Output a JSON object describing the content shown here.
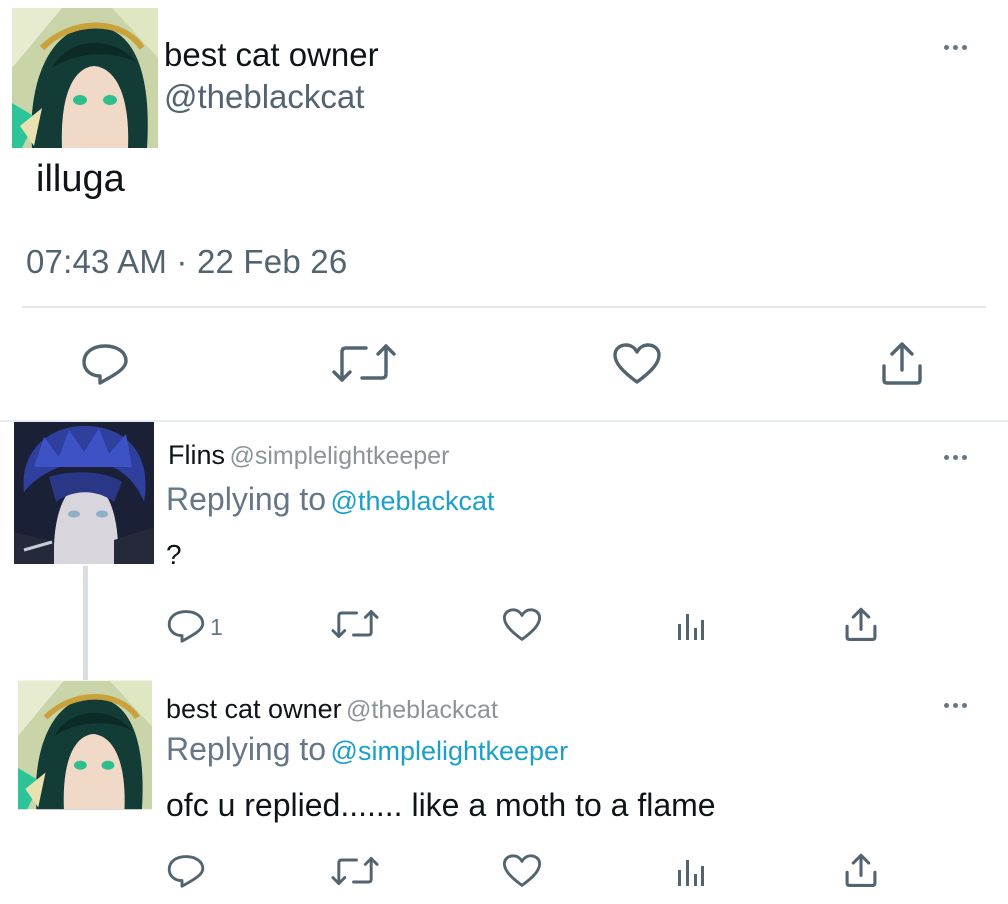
{
  "main_tweet": {
    "display_name": "best cat owner",
    "handle": "@theblackcat",
    "text": "illuga",
    "timestamp": "07:43 AM · 22 Feb 26",
    "actions": [
      "reply-icon",
      "retweet-icon",
      "like-icon",
      "share-icon"
    ]
  },
  "replies": [
    {
      "display_name": "Flins",
      "handle": "@simplelightkeeper",
      "replying_label": "Replying to",
      "replying_to": "@theblackcat",
      "text": "?",
      "reply_count": "1",
      "actions": [
        "reply-icon",
        "retweet-icon",
        "like-icon",
        "views-icon",
        "share-icon"
      ]
    },
    {
      "display_name": "best cat owner",
      "handle": "@theblackcat",
      "replying_label": "Replying to",
      "replying_to": "@simplelightkeeper",
      "text": "ofc u replied....... like a moth to a flame",
      "actions": [
        "reply-icon",
        "retweet-icon",
        "like-icon",
        "views-icon",
        "share-icon"
      ]
    }
  ],
  "colors": {
    "text": "#0f1419",
    "secondary": "#536471",
    "mention": "#1ba0c9",
    "icon": "#536471"
  }
}
